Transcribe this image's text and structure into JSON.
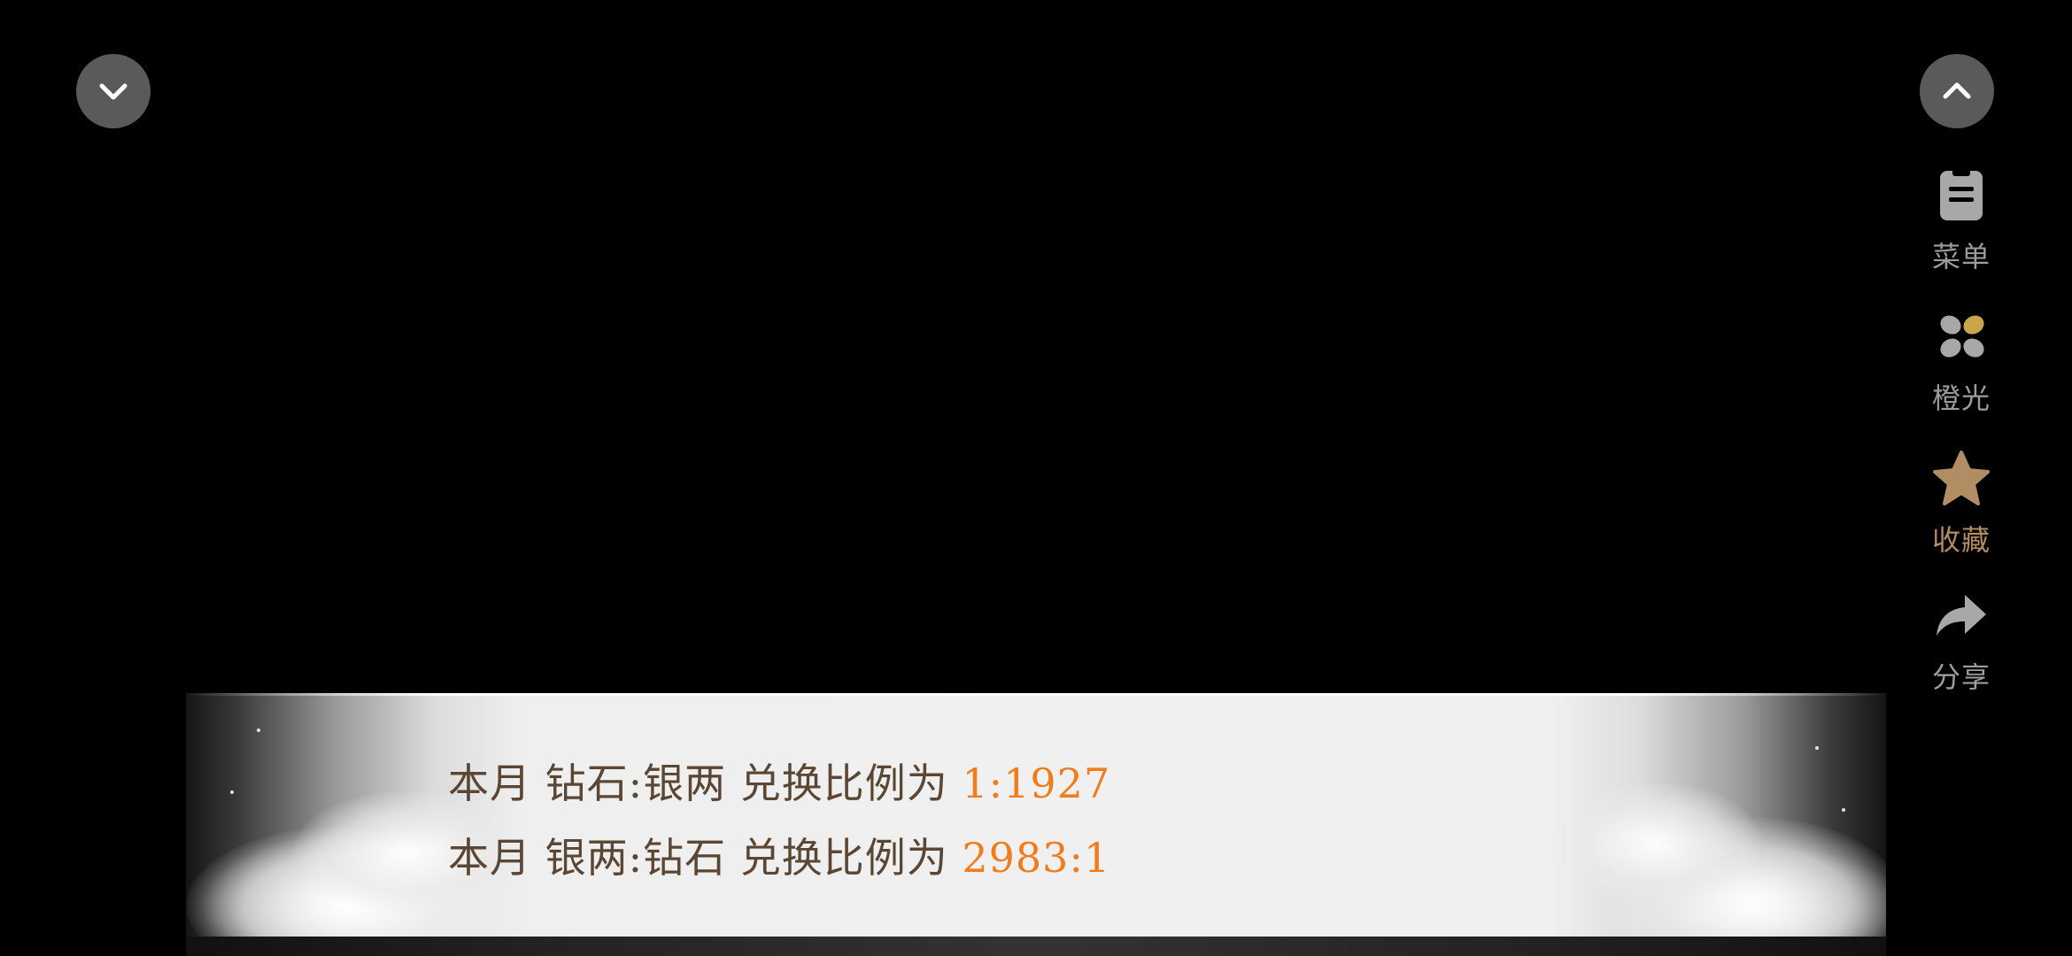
{
  "side_menu": {
    "menu_label": "菜单",
    "glow_label": "橙光",
    "favorite_label": "收藏",
    "share_label": "分享"
  },
  "banner": {
    "line1": {
      "prefix": "本月 钻石:银两 兑换比例为",
      "ratio": "1:1927"
    },
    "line2": {
      "prefix": "本月 银两:钻石 兑换比例为",
      "ratio": "2983:1"
    }
  },
  "icons": {
    "collapse": "chevron-down-icon",
    "expand": "chevron-up-icon",
    "menu": "clipboard-icon",
    "glow": "flower-icon",
    "favorite": "star-icon",
    "share": "share-arrow-icon"
  },
  "colors": {
    "ratio": "#f07d1c",
    "text": "#5a4632",
    "side_label": "#9c9c9c",
    "favorite_label": "#b28c62"
  }
}
